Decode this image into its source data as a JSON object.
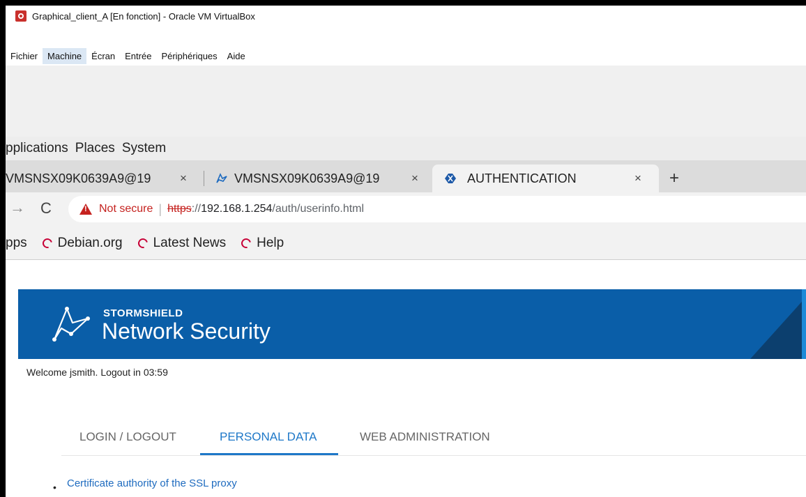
{
  "window": {
    "title": "Graphical_client_A [En fonction] - Oracle VM VirtualBox"
  },
  "vbox_menu": [
    "Fichier",
    "Machine",
    "Écran",
    "Entrée",
    "Périphériques",
    "Aide"
  ],
  "gnome_panel": [
    "pplications",
    "Places",
    "System"
  ],
  "browser": {
    "tabs": [
      {
        "label": "VMSNSX09K0639A9@19",
        "icon": "",
        "active": false
      },
      {
        "label": "VMSNSX09K0639A9@19",
        "icon": "stormshield-logo-icon",
        "active": false
      },
      {
        "label": "AUTHENTICATION",
        "icon": "stormshield-shield-icon",
        "active": true
      }
    ],
    "new_tab": "+",
    "close_glyph": "×",
    "address": {
      "security_label": "Not secure",
      "scheme": "https",
      "scheme_sep": "://",
      "host": "192.168.1.254",
      "path": "/auth/userinfo.html"
    },
    "bookmarks": [
      {
        "label": "pps",
        "icon": ""
      },
      {
        "label": "Debian.org",
        "icon": "debian-icon"
      },
      {
        "label": "Latest News",
        "icon": "debian-icon"
      },
      {
        "label": "Help",
        "icon": "debian-icon"
      }
    ]
  },
  "page": {
    "brand_small": "STORMSHIELD",
    "brand_large": "Network Security",
    "welcome": "Welcome jsmith. Logout in 03:59",
    "tabs": [
      "LOGIN / LOGOUT",
      "PERSONAL DATA",
      "WEB ADMINISTRATION"
    ],
    "active_tab": "PERSONAL DATA",
    "links": [
      "Certificate authority of the SSL proxy"
    ]
  },
  "colors": {
    "banner": "#0a5ea8",
    "accent": "#1e78c8",
    "warning": "#c5221f"
  }
}
